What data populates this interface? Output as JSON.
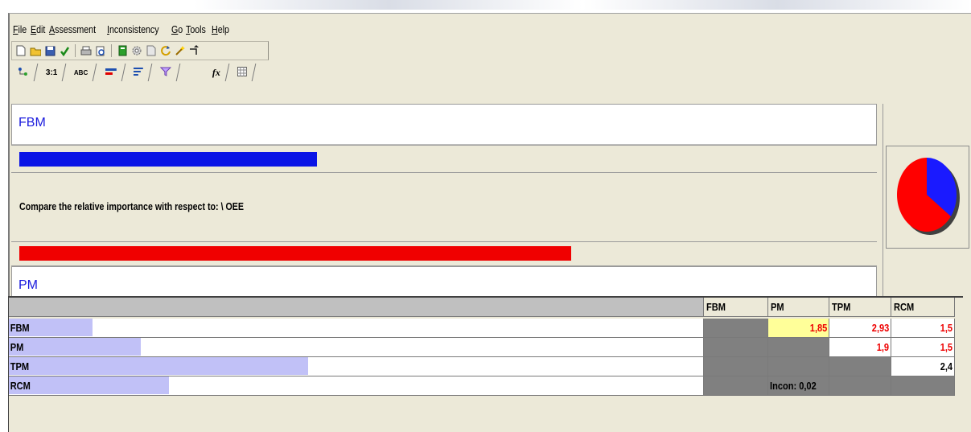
{
  "menu": [
    "File",
    "Edit",
    "Assessment",
    "Inconsistency",
    "Go",
    "Tools",
    "Help"
  ],
  "toolbar_icons": [
    "new-file-icon",
    "open-folder-icon",
    "save-icon",
    "check-icon",
    "print-icon",
    "print-preview-icon",
    "calculator-icon",
    "settings-icon",
    "page-icon",
    "refresh-icon",
    "wand-icon",
    "arrow-icon"
  ],
  "tabs": [
    {
      "name": "tab-tree",
      "label": ""
    },
    {
      "name": "tab-ratio",
      "label": "3:1"
    },
    {
      "name": "tab-abc",
      "label": "ABC"
    },
    {
      "name": "tab-graphic",
      "label": ""
    },
    {
      "name": "tab-bars",
      "label": ""
    },
    {
      "name": "tab-funnel",
      "label": ""
    },
    {
      "name": "tab-formula",
      "label": "fx"
    },
    {
      "name": "tab-matrix",
      "label": ""
    }
  ],
  "compare": {
    "top_element": "FBM",
    "bottom_element": "PM",
    "question": "Compare the relative importance with respect to:  \\ OEE",
    "top_bar_fraction": 0.35,
    "bottom_bar_fraction": 0.65,
    "top_color": "#0a14e6",
    "bottom_color": "#f00000"
  },
  "pie": {
    "slices": [
      {
        "label": "FBM",
        "fraction": 0.35,
        "color": "#1a1aff"
      },
      {
        "label": "PM",
        "fraction": 0.65,
        "color": "#ff0000"
      }
    ]
  },
  "matrix": {
    "columns": [
      "FBM",
      "PM",
      "TPM",
      "RCM"
    ],
    "rows": [
      {
        "name": "FBM",
        "weight": 0.12,
        "cells": [
          "",
          "1,85",
          "2,93",
          "1,5"
        ]
      },
      {
        "name": "PM",
        "weight": 0.19,
        "cells": [
          "",
          "",
          "1,9",
          "1,5"
        ]
      },
      {
        "name": "TPM",
        "weight": 0.43,
        "cells": [
          "",
          "",
          "",
          "2,4"
        ]
      },
      {
        "name": "RCM",
        "weight": 0.23,
        "cells": [
          "",
          "Incon: 0,02",
          "",
          ""
        ]
      }
    ],
    "bar_color": "#c1c1f7",
    "inconsistency_label": "Incon: 0,02"
  }
}
